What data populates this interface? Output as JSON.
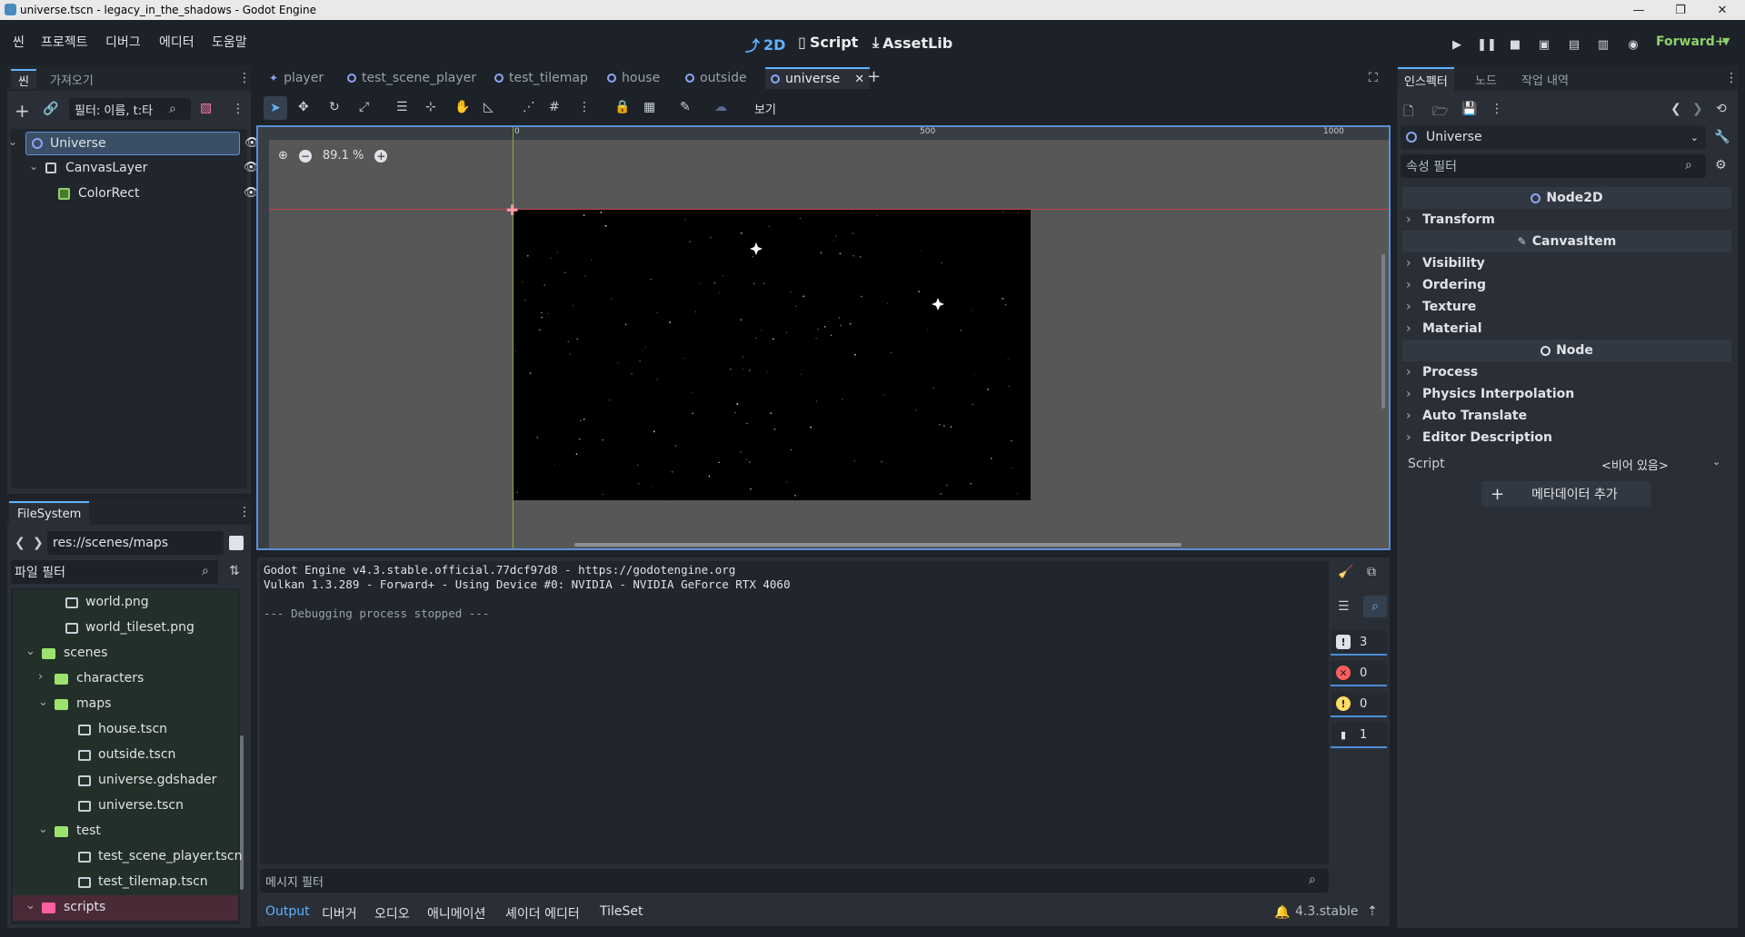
{
  "window": {
    "title": "universe.tscn - legacy_in_the_shadows - Godot Engine"
  },
  "menu": [
    "씬",
    "프로젝트",
    "디버그",
    "에디터",
    "도움말"
  ],
  "main_modes": [
    "2D",
    "Script",
    "AssetLib"
  ],
  "renderer": "Forward+",
  "left_dock": {
    "tabs": [
      "씬",
      "가져오기"
    ],
    "filter_placeholder": "필터: 이름, t:타"
  },
  "scene_tree": [
    {
      "name": "Universe",
      "depth": 0,
      "selected": true
    },
    {
      "name": "CanvasLayer",
      "depth": 1
    },
    {
      "name": "ColorRect",
      "depth": 2
    }
  ],
  "filesystem": {
    "tab": "FileSystem",
    "path": "res://scenes/maps",
    "filter_placeholder": "파일 필터",
    "items": [
      {
        "name": "world.png",
        "type": "image",
        "depth": 2
      },
      {
        "name": "world_tileset.png",
        "type": "image",
        "depth": 2
      },
      {
        "name": "scenes",
        "type": "folder",
        "depth": 1,
        "open": true
      },
      {
        "name": "characters",
        "type": "folder",
        "depth": 2,
        "open": false
      },
      {
        "name": "maps",
        "type": "folder",
        "depth": 2,
        "open": true
      },
      {
        "name": "house.tscn",
        "type": "scene",
        "depth": 3
      },
      {
        "name": "outside.tscn",
        "type": "scene",
        "depth": 3
      },
      {
        "name": "universe.gdshader",
        "type": "shader",
        "depth": 3
      },
      {
        "name": "universe.tscn",
        "type": "scene",
        "depth": 3
      },
      {
        "name": "test",
        "type": "folder",
        "depth": 2,
        "open": true
      },
      {
        "name": "test_scene_player.tscn",
        "type": "scene",
        "depth": 3
      },
      {
        "name": "test_tilemap.tscn",
        "type": "scene",
        "depth": 3
      },
      {
        "name": "scripts",
        "type": "folder-red",
        "depth": 1,
        "open": true
      }
    ]
  },
  "scene_tabs": [
    {
      "label": "player"
    },
    {
      "label": "test_scene_player"
    },
    {
      "label": "test_tilemap"
    },
    {
      "label": "house"
    },
    {
      "label": "outside"
    },
    {
      "label": "universe",
      "active": true
    }
  ],
  "viewport": {
    "view_menu": "보기",
    "zoom": "89.1 %",
    "ruler_labels": [
      "0",
      "500",
      "1000"
    ]
  },
  "output": {
    "lines": [
      "Godot Engine v4.3.stable.official.77dcf97d8 - https://godotengine.org",
      "Vulkan 1.3.289 - Forward+ - Using Device #0: NVIDIA - NVIDIA GeForce RTX 4060",
      "",
      "--- Debugging process stopped ---"
    ],
    "filter_placeholder": "메시지 필터",
    "counts": {
      "messages": "3",
      "errors": "0",
      "warnings": "0",
      "editor": "1"
    }
  },
  "bottom_tabs": [
    "Output",
    "디버거",
    "오디오",
    "애니메이션",
    "셰이더 에디터",
    "TileSet"
  ],
  "version": "4.3.stable",
  "inspector": {
    "tabs": [
      "인스펙터",
      "노드",
      "작업 내역"
    ],
    "node_name": "Universe",
    "filter_placeholder": "속성 필터",
    "sections": [
      {
        "kind": "class",
        "label": "Node2D"
      },
      {
        "kind": "group",
        "label": "Transform"
      },
      {
        "kind": "class",
        "label": "CanvasItem"
      },
      {
        "kind": "group",
        "label": "Visibility"
      },
      {
        "kind": "group",
        "label": "Ordering"
      },
      {
        "kind": "group",
        "label": "Texture"
      },
      {
        "kind": "group",
        "label": "Material"
      },
      {
        "kind": "class",
        "label": "Node"
      },
      {
        "kind": "group",
        "label": "Process"
      },
      {
        "kind": "group",
        "label": "Physics Interpolation"
      },
      {
        "kind": "group",
        "label": "Auto Translate"
      },
      {
        "kind": "group",
        "label": "Editor Description"
      }
    ],
    "script_label": "Script",
    "script_value": "<비어 있음>",
    "add_metadata": "메타데이터 추가"
  }
}
